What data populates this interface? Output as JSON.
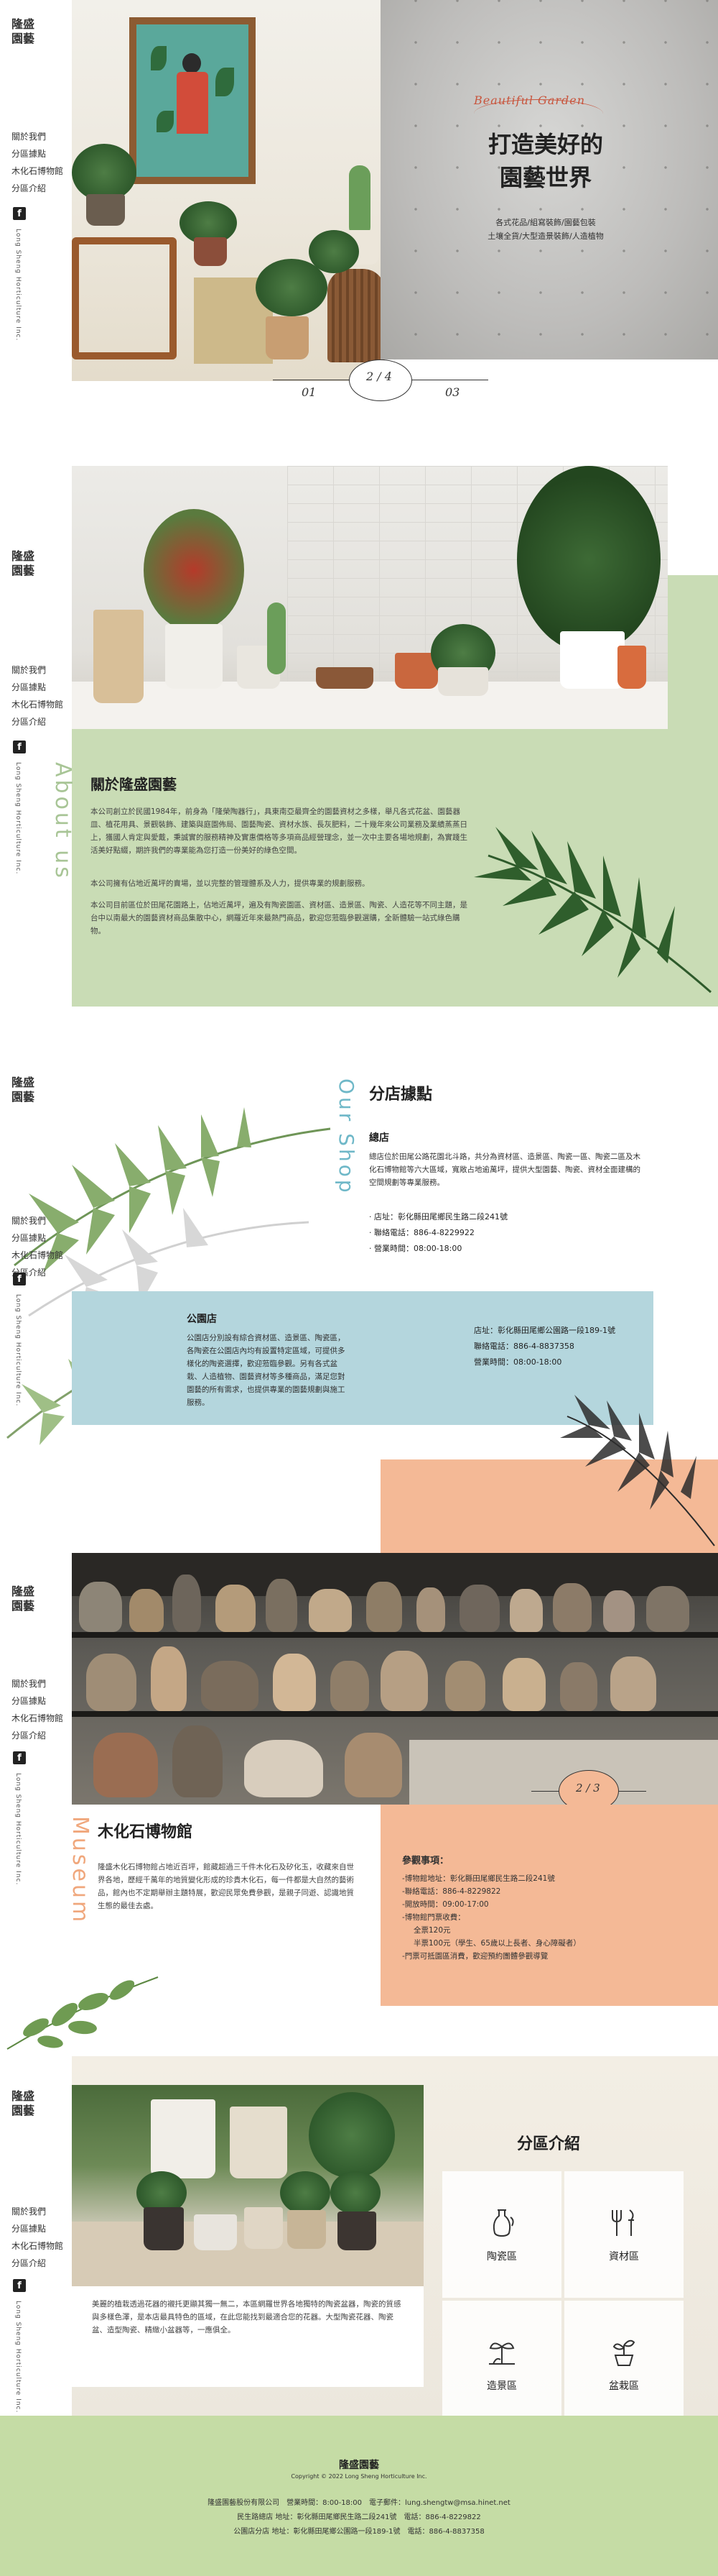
{
  "nav": {
    "logo_line1": "隆盛",
    "logo_line2": "園藝",
    "items": [
      "關於我們",
      "分區據點",
      "木化石博物館",
      "分區介紹"
    ],
    "vertical_text": "Long Sheng Horticulture Inc."
  },
  "hero": {
    "script_title": "Beautiful Garden",
    "title_line1": "打造美好的",
    "title_line2": "園藝世界",
    "sub_line1": "各式花品/組寫裝飾/園藝包裝",
    "sub_line2": "土壤全貨/大型造景裝飾/人造植物",
    "pager": {
      "current": "2",
      "sep": "/",
      "total": "4",
      "prev": "01",
      "next": "03"
    }
  },
  "about": {
    "title": "關於隆盛園藝",
    "en_vertical": "About us",
    "para1": "本公司創立於民國1984年，前身為「隆榮陶器行」，具東南亞最齊全的園藝資材之多樣，舉凡各式花盆、園藝器皿、植花用具、景觀裝飾、建築與庭園佈局、園藝陶瓷、資材水族、長灰肥料，二十幾年來公司業務及業績蒸蒸日上，獲國人肯定與愛戴，秉誠實的服務精神及實惠價格等多項商品經營理念，並一次中主要各場地規劃，為實踐生活美好點綴，期許我們的專業能為您打造一份美好的綠色空間。",
    "para2": "本公司擁有佔地近萬坪的賣場，並以完整的管理體系及人力，提供專業的規劃服務。",
    "para3": "本公司目前區位於田尾花園路上，佔地近萬坪，遍及有陶瓷園區、資材區、造景區、陶瓷、人造花等不同主題，是台中以南最大的園藝資材商品集散中心，網羅近年來最熱門商品，歡迎您蒞臨參觀選購，全新體驗一站式綠色購物。"
  },
  "shop": {
    "title": "分店據點",
    "en_vertical": "Our Shop",
    "main": {
      "name": "總店",
      "desc": "總店位於田尾公路花園北斗路，共分為資材區、造景區、陶瓷一區、陶瓷二區及木化石博物館等六大區域，寬敞占地逾萬坪，提供大型園藝、陶瓷、資材全面建構的空間規劃等專業服務。",
      "address": "‧ 店址：彰化縣田尾鄉民生路二段241號",
      "phone": "‧ 聯絡電話：886-4-8229922",
      "hours": "‧ 營業時間：08:00-18:00"
    },
    "branch": {
      "name": "公園店",
      "desc": "公園店分別設有綜合資材區、造景區、陶瓷區，各陶瓷在公園店內均有設置特定區域，可提供多樣化的陶瓷選擇，歡迎蒞臨參觀。另有各式盆栽、人造植物、園藝資材等多種商品，滿足您對園藝的所有需求，也提供專業的園藝規劃與施工服務。",
      "address": "店址：彰化縣田尾鄉公園路一段189-1號",
      "phone": "聯絡電話：886-4-8837358",
      "hours": "營業時間：08:00-18:00"
    }
  },
  "museum": {
    "title": "木化石博物館",
    "en_vertical": "Museum",
    "pager": {
      "current": "2",
      "sep": "/",
      "total": "3"
    },
    "desc": "隆盛木化石博物館占地近百坪，館藏超過三千件木化石及矽化玉，收藏來自世界各地，歷經千萬年的地質變化形成的珍貴木化石，每一件都是大自然的藝術品，館內也不定期舉辦主題特展，歡迎民眾免費參觀，是親子同遊、認識地質生態的最佳去處。",
    "info_title": "參觀事項：",
    "info_lines": [
      "-博物館地址：彰化縣田尾鄉民生路二段241號",
      "-聯絡電話：886-4-8229822",
      "-開放時間：09:00-17:00",
      "-博物館門票收費：",
      "  全票120元",
      "  半票100元（學生、65歲以上長者、身心障礙者）",
      "-門票可抵園區消費，歡迎預約團體參觀導覽"
    ]
  },
  "areas": {
    "title": "分區介紹",
    "tiles": [
      "陶瓷區",
      "資材區",
      "造景區",
      "盆栽區"
    ],
    "icons": [
      "vase-icon",
      "tools-icon",
      "landscape-icon",
      "potted-plant-icon"
    ],
    "desc": "美麗的植栽透過花器的襯托更顯其獨一無二，本區網羅世界各地獨特的陶瓷盆器，陶瓷的質感與多樣色澤，是本店最具特色的區域，在此您能找到最適合您的花器。大型陶瓷花器、陶瓷盆、造型陶瓷、精緻小盆器等，一應俱全。"
  },
  "footer": {
    "brand": "隆盛園藝",
    "copyright": "Copyright © 2022 Long Sheng Horticulture Inc.",
    "line1": "隆盛園藝股份有限公司　營業時間：8:00-18:00　電子郵件：lung.shengtw@msa.hinet.net",
    "line2": "民生路總店 地址：彰化縣田尾鄉民生路二段241號　電話：886-4-8229822",
    "line3": "公園店分店 地址：彰化縣田尾鄉公園路一段189-1號　電話：886-4-8837358"
  },
  "colors": {
    "sage_green": "#c9dcb5",
    "sky_blue": "#b4d6dd",
    "peach": "#f4b996",
    "footer_green": "#c5dca5",
    "accent_red": "#c8553d"
  }
}
